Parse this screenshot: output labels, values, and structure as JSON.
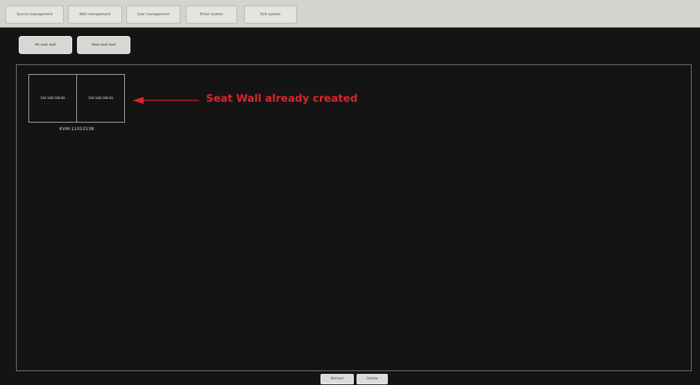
{
  "menu": {
    "items": [
      {
        "label": "Source management"
      },
      {
        "label": "Wall management"
      },
      {
        "label": "User management"
      },
      {
        "label": "Enter system"
      },
      {
        "label": "Exit system"
      }
    ]
  },
  "toolbar": {
    "all_seat_wall_label": "All seat wall",
    "new_seat_wall_label": "New seat wall"
  },
  "wall": {
    "screens": [
      {
        "ip": "192.168.168.82"
      },
      {
        "ip": "192.168.168.83"
      }
    ],
    "name": "KVM-11053138"
  },
  "annotation": {
    "text": "Seat Wall already created",
    "color": "#d8262a",
    "icon": "left-arrow-icon"
  },
  "footer": {
    "refresh_label": "Refresh",
    "delete_label": "Delete"
  }
}
